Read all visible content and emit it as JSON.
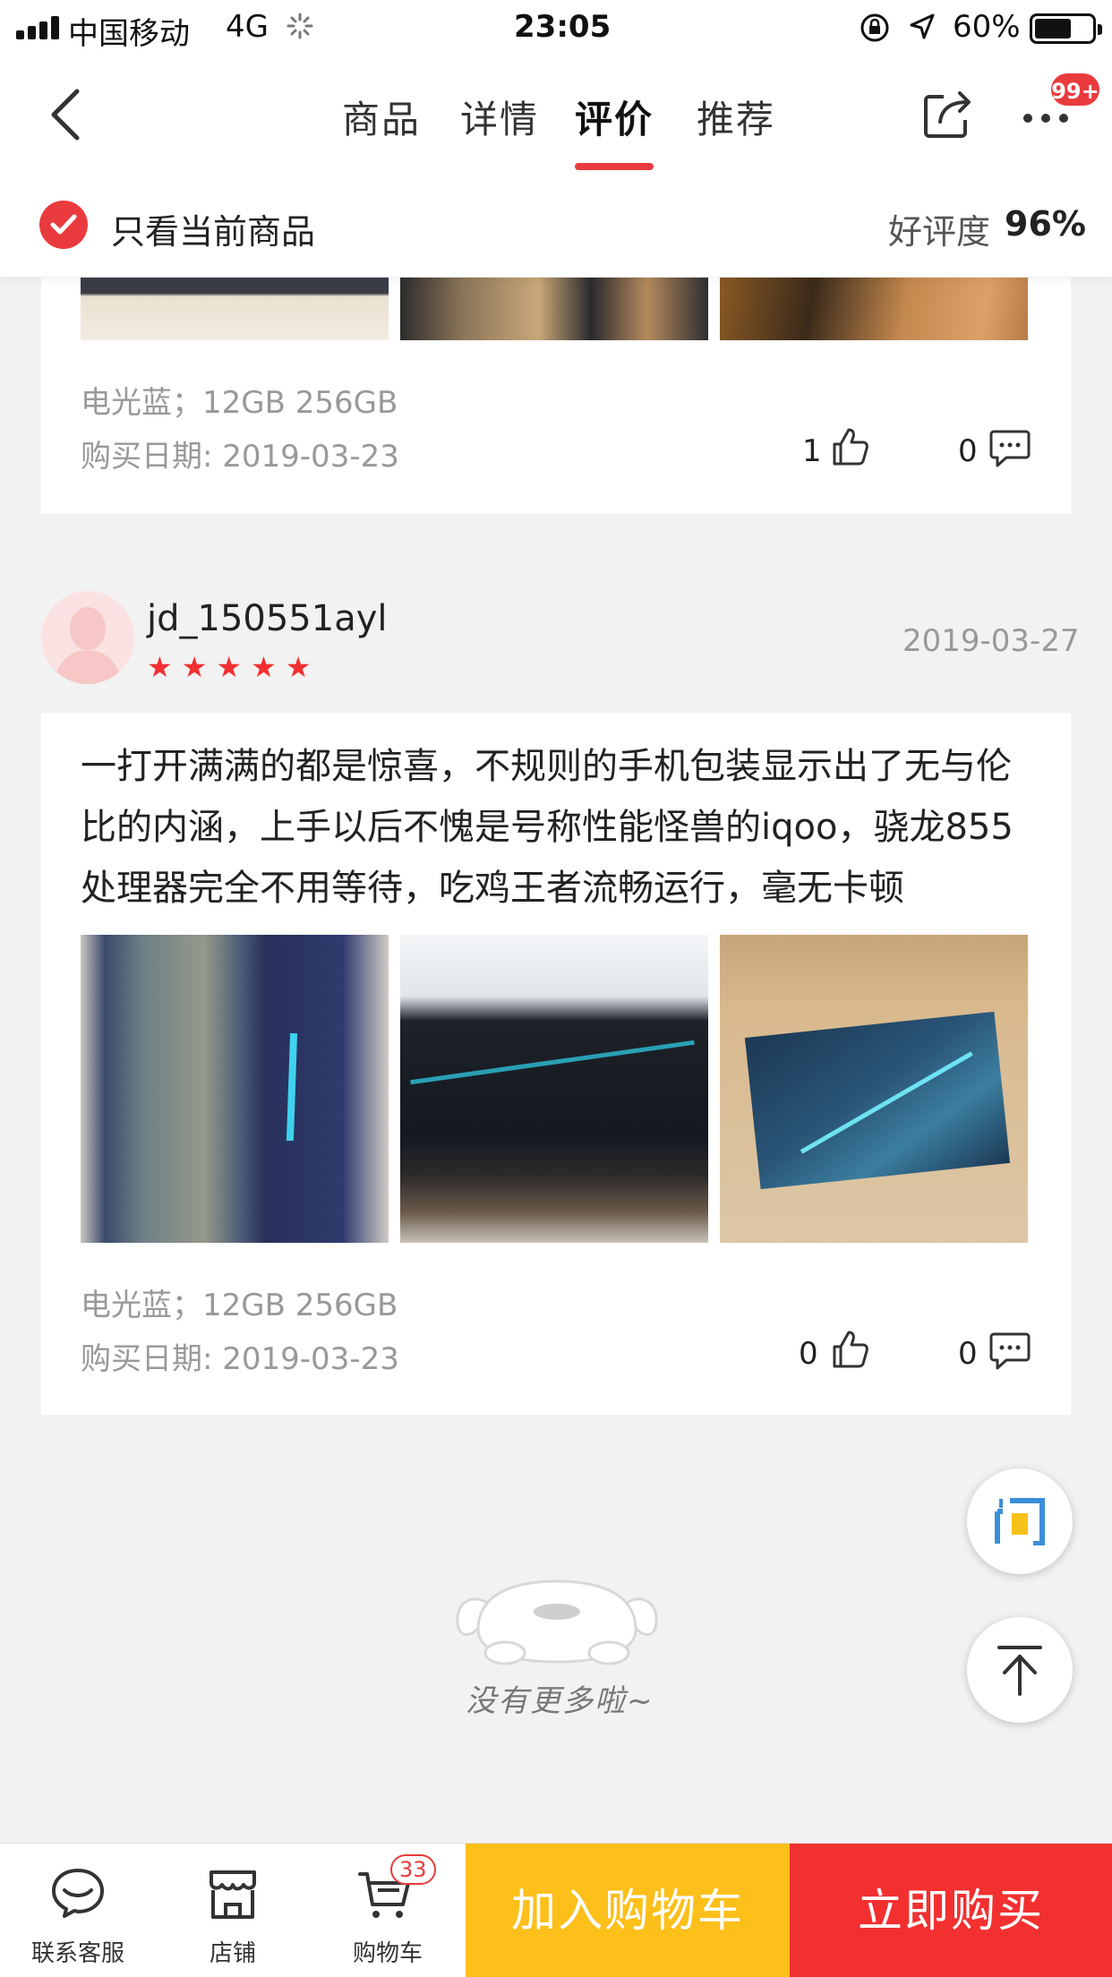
{
  "status_bar": {
    "carrier": "中国移动",
    "network": "4G",
    "time": "23:05",
    "battery": "60%"
  },
  "nav": {
    "tabs": [
      {
        "label": "商品",
        "active": false
      },
      {
        "label": "详情",
        "active": false
      },
      {
        "label": "评价",
        "active": true
      },
      {
        "label": "推荐",
        "active": false
      }
    ],
    "badge": "99+"
  },
  "filter": {
    "only_current_label": "只看当前商品",
    "rating_label": "好评度",
    "rating_value": "96%"
  },
  "reviews": [
    {
      "variant": "电光蓝；12GB  256GB",
      "purchase_date": "购买日期: 2019-03-23",
      "likes": "1",
      "comments": "0"
    },
    {
      "username": "jd_150551ayl",
      "date": "2019-03-27",
      "stars": 5,
      "text": "一打开满满的都是惊喜，不规则的手机包装显示出了无与伦比的内涵，上手以后不愧是号称性能怪兽的iqoo，骁龙855处理器完全不用等待，吃鸡王者流畅运行，毫无卡顿",
      "variant": "电光蓝；12GB  256GB",
      "purchase_date": "购买日期: 2019-03-23",
      "likes": "0",
      "comments": "0"
    }
  ],
  "no_more": "没有更多啦~",
  "bottom_bar": {
    "service_label": "联系客服",
    "shop_label": "店铺",
    "cart_label": "购物车",
    "cart_count": "33",
    "add_to_cart": "加入购物车",
    "buy_now": "立即购买"
  },
  "colors": {
    "accent_red": "#e93b3d",
    "buy_red": "#f23030",
    "cart_yellow": "#fdbf1a"
  }
}
